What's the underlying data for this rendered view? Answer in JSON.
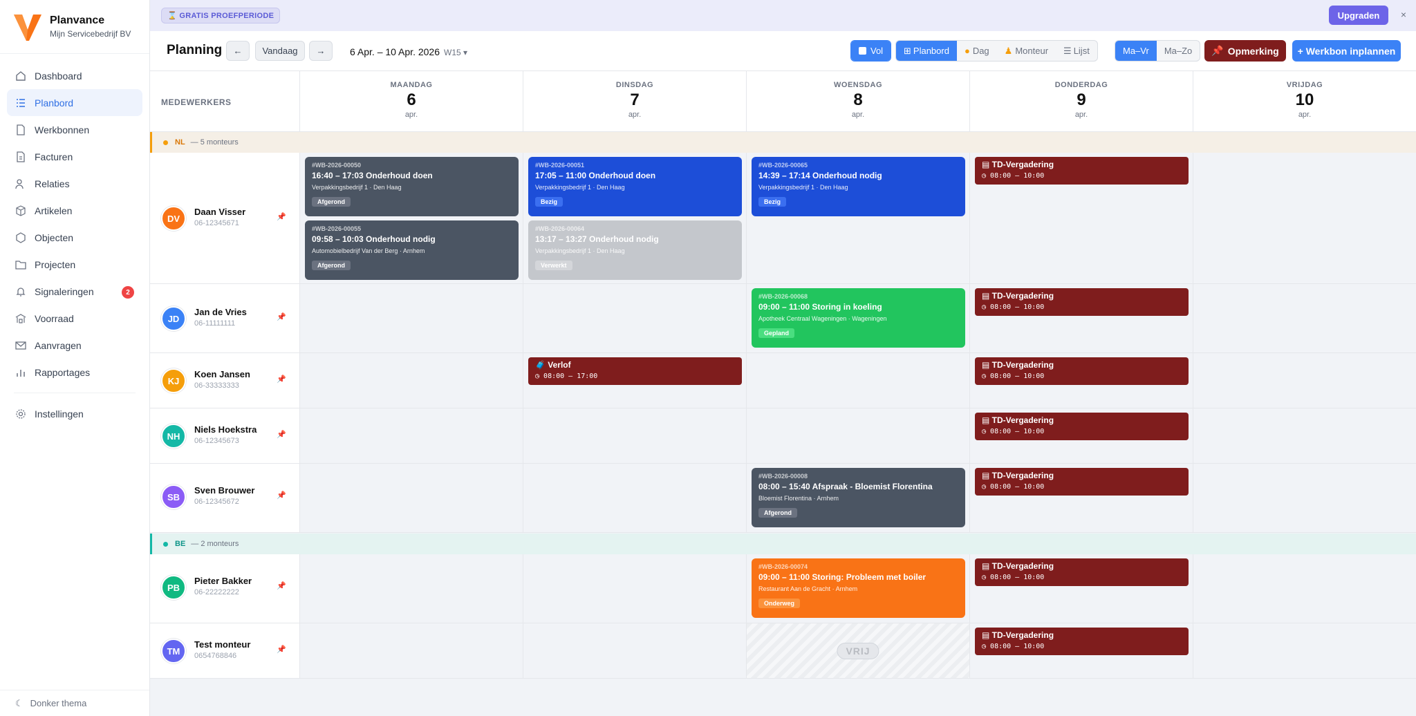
{
  "brand": {
    "name": "Planvance",
    "sub": "Mijn Servicebedrijf BV"
  },
  "nav": [
    {
      "label": "Dashboard",
      "icon": "home-icon"
    },
    {
      "label": "Planbord",
      "icon": "list-icon",
      "active": true
    },
    {
      "label": "Werkbonnen",
      "icon": "document-icon"
    },
    {
      "label": "Facturen",
      "icon": "invoice-icon"
    },
    {
      "label": "Relaties",
      "icon": "users-icon"
    },
    {
      "label": "Artikelen",
      "icon": "box-icon"
    },
    {
      "label": "Objecten",
      "icon": "hexagon-icon"
    },
    {
      "label": "Projecten",
      "icon": "folder-icon"
    },
    {
      "label": "Signaleringen",
      "icon": "bell-icon",
      "badge": "2"
    },
    {
      "label": "Voorraad",
      "icon": "warehouse-icon"
    },
    {
      "label": "Aanvragen",
      "icon": "mail-icon"
    },
    {
      "label": "Rapportages",
      "icon": "chart-icon"
    }
  ],
  "settings_label": "Instellingen",
  "theme_label": "Donker thema",
  "trial": {
    "label": "GRATIS PROEFPERIODE",
    "upgrade": "Upgraden",
    "close": "×"
  },
  "toolbar": {
    "title": "Planning",
    "prev": "←",
    "today": "Vandaag",
    "next": "→",
    "range": "6 Apr. – 10 Apr. 2026",
    "week": "W15 ▾",
    "vol": "Vol",
    "views": [
      "Planbord",
      "Dag",
      "Monteur",
      "Lijst"
    ],
    "weekmodes": [
      "Ma–Vr",
      "Ma–Zo"
    ],
    "remark": "Opmerking",
    "schedule": "+ Werkbon inplannen"
  },
  "colors": {
    "accent": "#3b82f6",
    "dark_red": "#7f1d1d",
    "done": "#4b5563",
    "busy": "#1d4ed8",
    "planned": "#22c55e",
    "enroute": "#f97316"
  },
  "grid": {
    "employees_header": "MEDEWERKERS",
    "days": [
      {
        "name": "MAANDAG",
        "date": "6",
        "month": "apr."
      },
      {
        "name": "DINSDAG",
        "date": "7",
        "month": "apr."
      },
      {
        "name": "WOENSDAG",
        "date": "8",
        "month": "apr."
      },
      {
        "name": "DONDERDAG",
        "date": "9",
        "month": "apr."
      },
      {
        "name": "VRIJDAG",
        "date": "10",
        "month": "apr."
      }
    ],
    "groups": [
      {
        "code": "NL",
        "count": "— 5 monteurs"
      },
      {
        "code": "BE",
        "count": "— 2 monteurs"
      }
    ],
    "employees": [
      {
        "initials": "DV",
        "name": "Daan Visser",
        "phone": "06-12345671"
      },
      {
        "initials": "JD",
        "name": "Jan de Vries",
        "phone": "06-11111111"
      },
      {
        "initials": "KJ",
        "name": "Koen Jansen",
        "phone": "06-33333333"
      },
      {
        "initials": "NH",
        "name": "Niels Hoekstra",
        "phone": "06-12345673"
      },
      {
        "initials": "SB",
        "name": "Sven Brouwer",
        "phone": "06-12345672"
      },
      {
        "initials": "PB",
        "name": "Pieter Bakker",
        "phone": "06-22222222"
      },
      {
        "initials": "TM",
        "name": "Test monteur",
        "phone": "0654768846"
      }
    ],
    "cards": [
      {
        "id": "#WB-2026-00050",
        "title": "16:40 – 17:03 Onderhoud doen",
        "sub": "Verpakkingsbedrijf 1 · Den Haag",
        "status": "Afgerond"
      },
      {
        "id": "#WB-2026-00055",
        "title": "09:58 – 10:03 Onderhoud nodig",
        "sub": "Automobielbedrijf Van der Berg · Arnhem",
        "status": "Afgerond"
      },
      {
        "id": "#WB-2026-00051",
        "title": "17:05 – 11:00 Onderhoud doen",
        "sub": "Verpakkingsbedrijf 1 · Den Haag",
        "status": "Bezig"
      },
      {
        "id": "#WB-2026-00064",
        "title": "13:17 – 13:27 Onderhoud nodig",
        "sub": "Verpakkingsbedrijf 1 · Den Haag",
        "status": "Verwerkt"
      },
      {
        "id": "#WB-2026-00065",
        "title": "14:39 – 17:14 Onderhoud nodig",
        "sub": "Verpakkingsbedrijf 1 · Den Haag",
        "status": "Bezig"
      },
      {
        "id": "#WB-2026-00068",
        "title": "09:00 – 11:00 Storing in koeling",
        "sub": "Apotheek Centraal Wageningen · Wageningen",
        "status": "Gepland"
      },
      {
        "id": "#WB-2026-00008",
        "title": "08:00 – 15:40 Afspraak - Bloemist Florentina",
        "sub": "Bloemist Florentina · Arnhem",
        "status": "Afgerond"
      },
      {
        "id": "#WB-2026-00074",
        "title": "09:00 – 11:00 Storing: Probleem met boiler",
        "sub": "Restaurant Aan de Gracht · Arnhem",
        "status": "Onderweg"
      }
    ],
    "meeting": {
      "title": "TD-Vergadering",
      "time": "08:00 – 10:00"
    },
    "leave": {
      "title": "Verlof",
      "time": "08:00 – 17:00"
    },
    "free_label": "VRIJ"
  }
}
